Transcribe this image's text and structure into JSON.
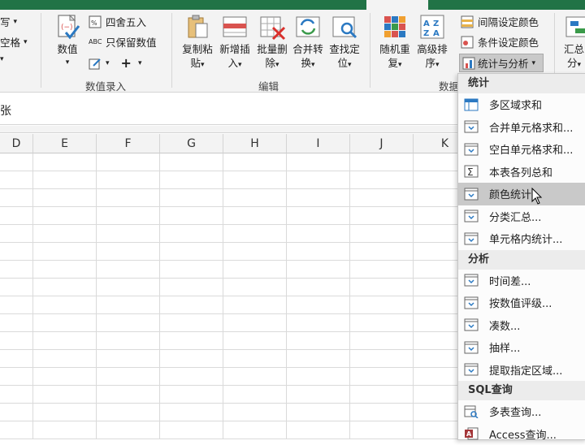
{
  "ribbon": {
    "left_partial": {
      "row1": "写",
      "row2": "空格"
    },
    "numbers": {
      "value_btn": "数值",
      "round_label": "四舍五入",
      "keep_value_label": "只保留数值",
      "group_label": "数值录入"
    },
    "edit": {
      "copy_paste": [
        "复制粘",
        "贴"
      ],
      "insert_new": [
        "新增插",
        "入"
      ],
      "batch_delete": [
        "批量删",
        "除"
      ],
      "merge_convert": [
        "合并转",
        "换"
      ],
      "find_locate": [
        "查找定",
        "位"
      ],
      "group_label": "编辑"
    },
    "data": {
      "random_repeat": [
        "随机重",
        "复"
      ],
      "advanced_sort": [
        "高级排",
        "序"
      ],
      "interval_color": "间隔设定颜色",
      "conditional_color": "条件设定颜色",
      "stats_analysis": "统计与分析",
      "group_label_partial": "数据",
      "summary_partial": [
        "汇总",
        "分"
      ]
    }
  },
  "formula_bar": {
    "text": "张"
  },
  "columns": [
    "D",
    "E",
    "F",
    "G",
    "H",
    "I",
    "J",
    "K"
  ],
  "menu": {
    "sections": [
      {
        "title": "统计",
        "items": [
          "多区域求和",
          "合并单元格求和...",
          "空白单元格求和...",
          "本表各列总和",
          "颜色统计",
          "分类汇总...",
          "单元格内统计..."
        ]
      },
      {
        "title": "分析",
        "items": [
          "时间差...",
          "按数值评级...",
          "凑数...",
          "抽样...",
          "提取指定区域..."
        ]
      },
      {
        "title": "SQL查询",
        "items": [
          "多表查询...",
          "Access查询..."
        ]
      }
    ],
    "highlighted": "颜色统计"
  }
}
